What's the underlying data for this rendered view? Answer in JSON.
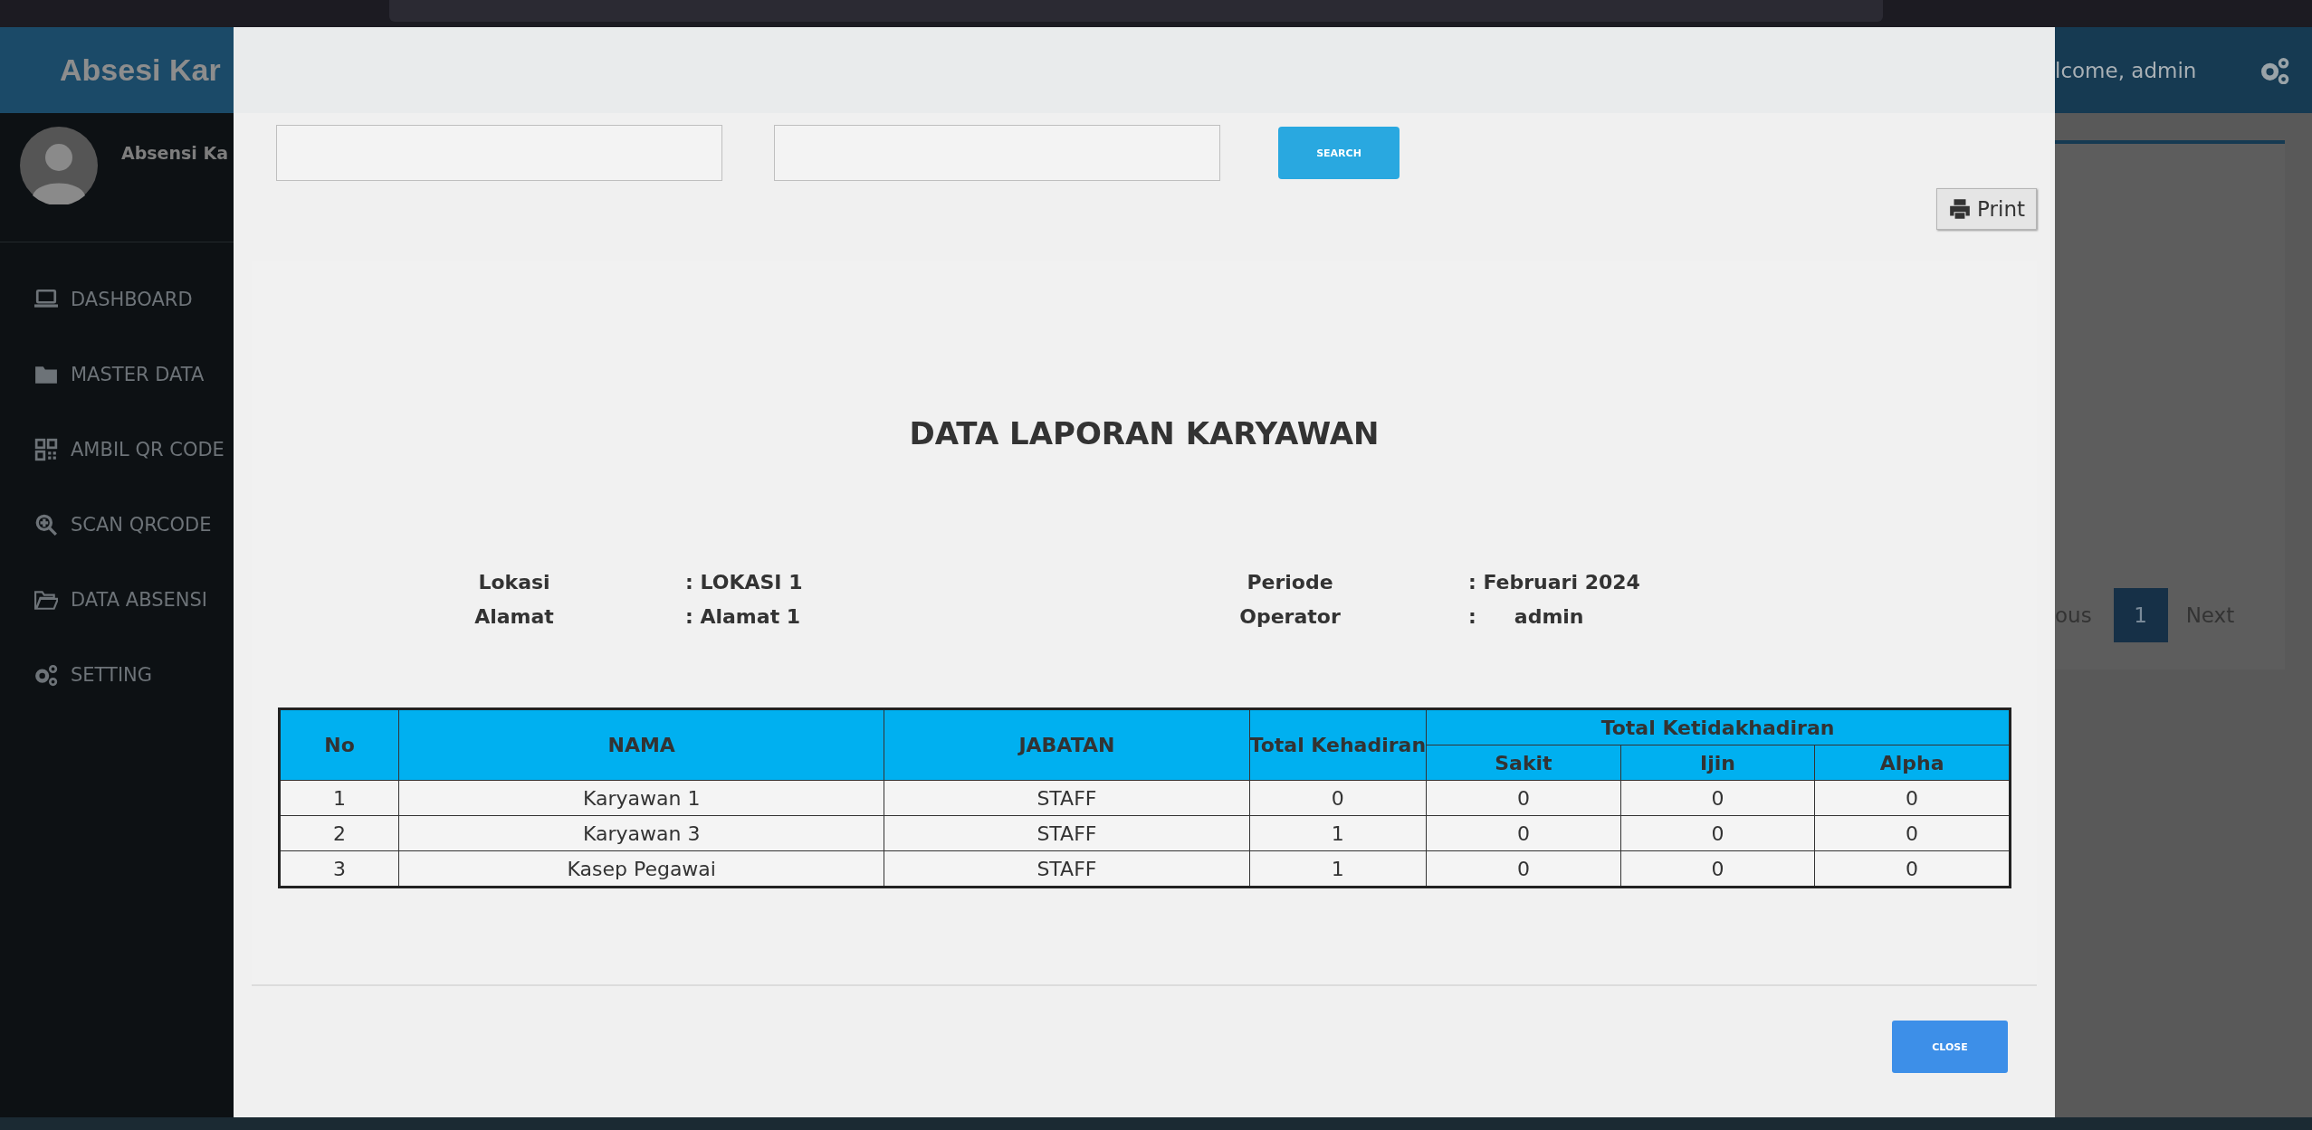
{
  "app": {
    "brand": "Absesi Kar",
    "user_name": "Absensi Ka",
    "welcome": "lcome, admin"
  },
  "sidebar": {
    "items": [
      {
        "label": "DASHBOARD"
      },
      {
        "label": "MASTER DATA"
      },
      {
        "label": "AMBIL QR CODE"
      },
      {
        "label": "SCAN QRCODE"
      },
      {
        "label": "DATA ABSENSI"
      },
      {
        "label": "SETTING"
      }
    ]
  },
  "pagination": {
    "previous": "ous",
    "pages": [
      {
        "label": "1",
        "selected": true
      }
    ],
    "next": "Next"
  },
  "modal": {
    "search_button": "SEARCH",
    "print_button": "Print",
    "title": "DATA LAPORAN KARYAWAN",
    "info_left": [
      {
        "label": "Lokasi",
        "value": ": LOKASI 1"
      },
      {
        "label": "Alamat",
        "value": ": Alamat 1"
      }
    ],
    "info_right": [
      {
        "label": "Periode",
        "value": ": Februari 2024"
      },
      {
        "label": "Operator",
        "sep": ":",
        "value": "admin"
      }
    ],
    "table": {
      "header": {
        "no": "No",
        "name": "NAMA",
        "position": "JABATAN",
        "present": "Total Kehadiran",
        "absent_group": "Total Ketidakhadiran",
        "absent": [
          "Sakit",
          "Ijin",
          "Alpha"
        ]
      },
      "rows": [
        [
          "1",
          "Karyawan 1",
          "STAFF",
          "0",
          "0",
          "0",
          "0"
        ],
        [
          "2",
          "Karyawan 3",
          "STAFF",
          "1",
          "0",
          "0",
          "0"
        ],
        [
          "3",
          "Kasep Pegawai",
          "STAFF",
          "1",
          "0",
          "0",
          "0"
        ]
      ]
    },
    "close_button": "CLOSE"
  }
}
